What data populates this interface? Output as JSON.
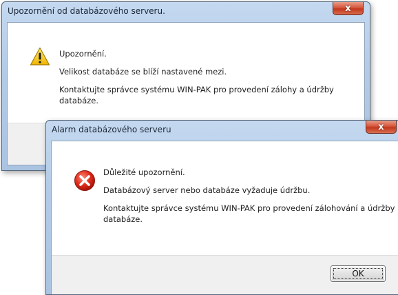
{
  "warning_dialog": {
    "title": "Upozornění od databázového serveru.",
    "close_glyph": "x",
    "icon": "warning-triangle-icon",
    "heading": "Upozornění.",
    "line1": "Velikost databáze se blíží nastavené mezi.",
    "line2": "Kontaktujte správce systému WIN-PAK pro provedení zálohy a údržby databáze."
  },
  "alarm_dialog": {
    "title": "Alarm databázového serveru",
    "close_glyph": "x",
    "icon": "error-x-icon",
    "heading": "Důležité upozornění.",
    "line1": "Databázový server nebo databáze vyžaduje údržbu.",
    "line2": "Kontaktujte správce systému WIN-PAK pro provedení zálohování a údržby databáze.",
    "ok_label": "OK"
  }
}
